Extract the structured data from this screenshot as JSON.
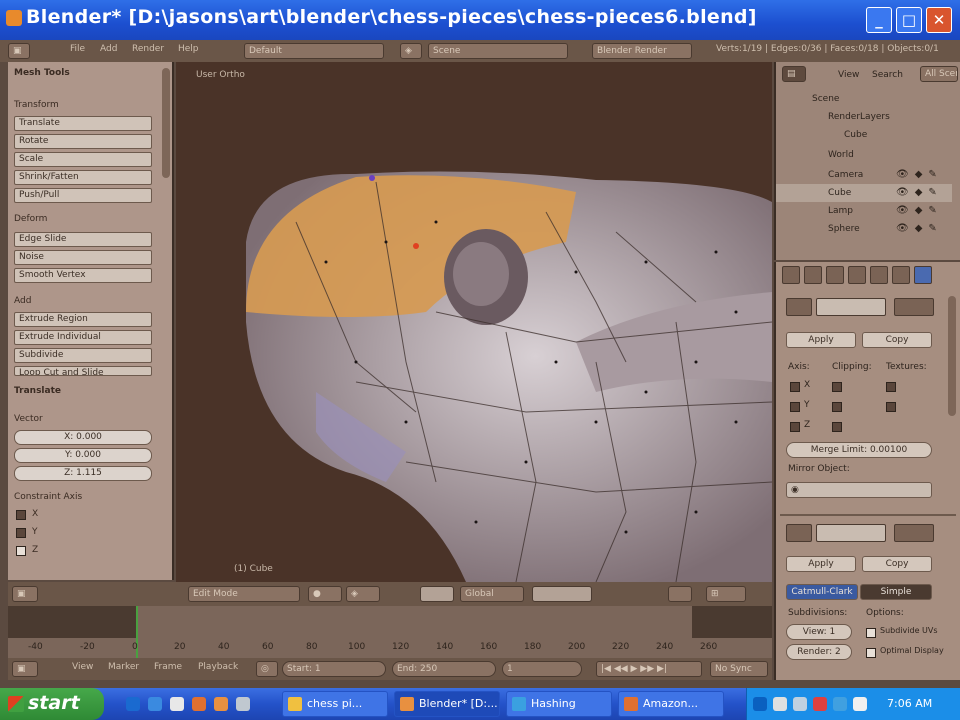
{
  "window": {
    "title": "Blender* [D:\\jasons\\art\\blender\\chess-pieces\\chess-pieces6.blend]"
  },
  "toolshelf": {
    "header": "Mesh Tools",
    "sections": [
      {
        "title": "Transform",
        "buttons": [
          "Translate",
          "Rotate",
          "Scale",
          "Shrink/Fatten",
          "Push/Pull"
        ]
      },
      {
        "title": "Deform",
        "buttons": [
          "Edge Slide",
          "Noise",
          "Smooth Vertex"
        ]
      },
      {
        "title": "Add",
        "buttons": [
          "Extrude Region",
          "Extrude Individual",
          "Subdivide",
          "Loop Cut and Slide"
        ]
      }
    ],
    "operator": "Translate",
    "vector_label": "Vector",
    "vector": [
      "X: 0.000",
      "Y: 0.000",
      "Z: 1.115"
    ],
    "constraint_label": "Constraint Axis",
    "constraint": [
      "X",
      "Y",
      "Z"
    ]
  },
  "viewport": {
    "label_top": "User Ortho",
    "label_bottom": "(1) Cube"
  },
  "outliner": {
    "views": [
      "View",
      "Search",
      "All Scenes"
    ],
    "rows": [
      "Scene",
      "RenderLayers",
      "Cube",
      "World",
      "Camera",
      "Cube",
      "Lamp",
      "Sphere"
    ]
  },
  "properties": {
    "modifier_buttons": [
      "Apply",
      "Copy"
    ],
    "axis_label": "Axis:",
    "clipping_label": "Clipping:",
    "texture_label": "Textures:",
    "axis": [
      "X",
      "Y",
      "Z"
    ],
    "merge_button": "Merge Limit: 0.00100",
    "mirror_object_label": "Mirror Object:",
    "apply_copy_2": [
      "Apply",
      "Copy"
    ],
    "tabs": [
      "Catmull-Clark",
      "Simple"
    ],
    "subdivisions_label": "Subdivisions:",
    "options_label": "Options:",
    "view_field": "View: 1",
    "render_field": "Render: 2",
    "opt_subdiv_uv": "Subdivide UVs",
    "opt_optimal": "Optimal Display"
  },
  "viewport_header": {
    "mode": "Edit Mode",
    "pivot": "Global"
  },
  "timeline": {
    "ticks": [
      "-40",
      "-20",
      "0",
      "20",
      "40",
      "60",
      "80",
      "100",
      "120",
      "140",
      "160",
      "180",
      "200",
      "220",
      "240",
      "260"
    ]
  },
  "timeline_header": {
    "menus": [
      "View",
      "Marker",
      "Frame",
      "Playback"
    ],
    "start": "Start: 1",
    "end": "End: 250",
    "current": "1",
    "sync": "No Sync"
  },
  "top_header": {
    "menus": [
      "File",
      "Add",
      "Render",
      "Help"
    ],
    "layout": "Default",
    "scene": "Scene",
    "engine": "Blender Render",
    "stats": "Verts:1/19 | Edges:0/36 | Faces:0/18 | Objects:0/1"
  },
  "taskbar": {
    "start": "start",
    "tasks": [
      "chess pi...",
      "Blender* [D:...",
      "Hashing",
      "Amazon..."
    ],
    "clock": "7:06 AM"
  },
  "colors": {
    "accent": "#2452c9",
    "start_green": "#2f8a35",
    "selection": "#e8a040"
  }
}
